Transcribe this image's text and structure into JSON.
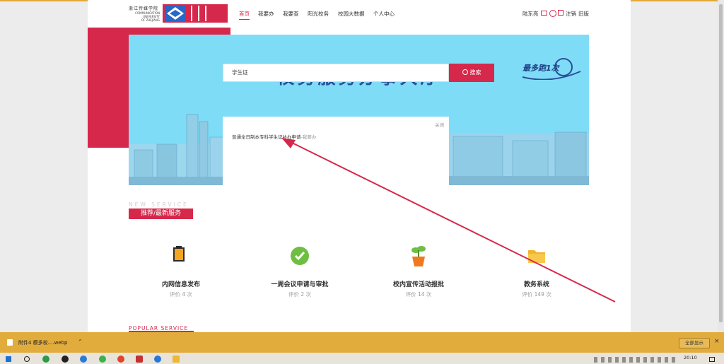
{
  "header": {
    "logo_cn": "浙江传媒学院",
    "logo_en_1": "COMMUNICATION",
    "logo_en_2": "UNIVERSITY",
    "logo_en_3": "OF ZHEJIANG",
    "nav": [
      "首页",
      "我要办",
      "我要查",
      "阳光校务",
      "校园大数据",
      "个人中心"
    ],
    "user_name": "陆东亮",
    "logout": "注销",
    "old_version": "旧版"
  },
  "banner": {
    "title": "校务服务办事大厅",
    "slogan": "最多跑1次"
  },
  "search": {
    "value": "学生证",
    "button_label": "搜索",
    "close_label": "关闭",
    "suggestion_main": "普通全日制本专科学生证补办申请",
    "suggestion_sub": "-我要办"
  },
  "new_service": {
    "en_label": "NEW SERVICE",
    "tag": "推荐/最新服务",
    "items": [
      {
        "name": "内网信息发布",
        "rating": "评价 4 次",
        "icon": "clipboard-icon"
      },
      {
        "name": "一周会议申请与审批",
        "rating": "评价 2 次",
        "icon": "check-badge-icon"
      },
      {
        "name": "校内宣传活动报批",
        "rating": "评价 14 次",
        "icon": "plant-pot-icon"
      },
      {
        "name": "教务系统",
        "rating": "评价 149 次",
        "icon": "folder-icon"
      }
    ]
  },
  "popular_service": {
    "en_label": "POPULAR SERVICE"
  },
  "download_bar": {
    "filename": "附件4 模多校....webp",
    "show_all": "全部显示"
  },
  "taskbar": {
    "time": "20:10"
  },
  "colors": {
    "brand_red": "#d6284b",
    "banner_blue": "#7fdcf6",
    "title_blue": "#2a4f9a",
    "download_bar": "#e2ac3c"
  }
}
